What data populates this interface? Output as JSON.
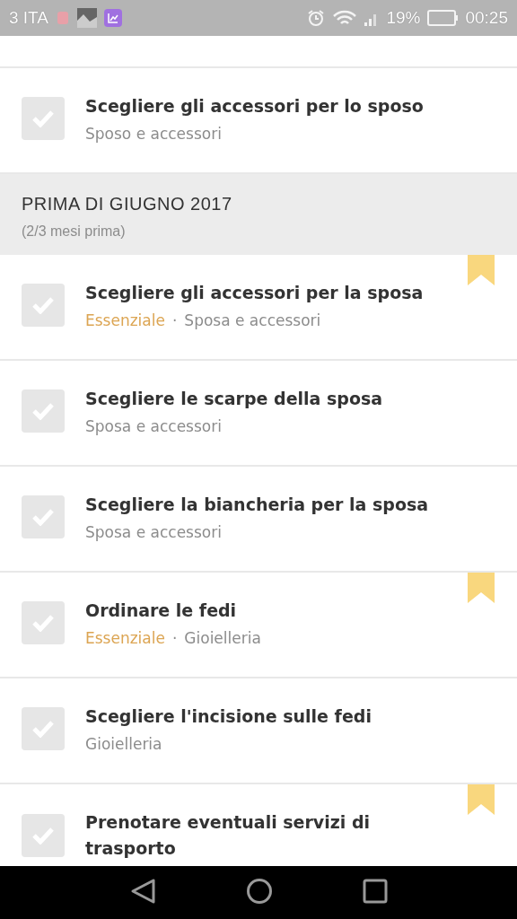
{
  "status_bar": {
    "carrier": "3 ITA",
    "battery": "19%",
    "time": "00:25"
  },
  "groups": [
    {
      "kind": "items",
      "tasks": [
        {
          "title": "Scegliere gli accessori per lo sposo",
          "category": "Sposo e accessori",
          "checked": false,
          "bookmarked": false
        }
      ]
    },
    {
      "kind": "header",
      "title": "PRIMA DI GIUGNO 2017",
      "subtitle": "(2/3 mesi prima)"
    },
    {
      "kind": "items",
      "tasks": [
        {
          "title": "Scegliere gli accessori per la sposa",
          "tag": "Essenziale",
          "separator": "·",
          "category": "Sposa e accessori",
          "checked": false,
          "bookmarked": true
        },
        {
          "title": "Scegliere le scarpe della sposa",
          "category": "Sposa e accessori",
          "checked": false,
          "bookmarked": false
        },
        {
          "title": "Scegliere la biancheria per la sposa",
          "category": "Sposa e accessori",
          "checked": false,
          "bookmarked": false
        },
        {
          "title": "Ordinare le fedi",
          "tag": "Essenziale",
          "separator": "·",
          "category": "Gioielleria",
          "checked": false,
          "bookmarked": true
        },
        {
          "title": "Scegliere l'incisione sulle fedi",
          "category": "Gioielleria",
          "checked": false,
          "bookmarked": false
        },
        {
          "title": "Prenotare eventuali servizi di trasporto",
          "checked": false,
          "bookmarked": true
        }
      ]
    }
  ]
}
